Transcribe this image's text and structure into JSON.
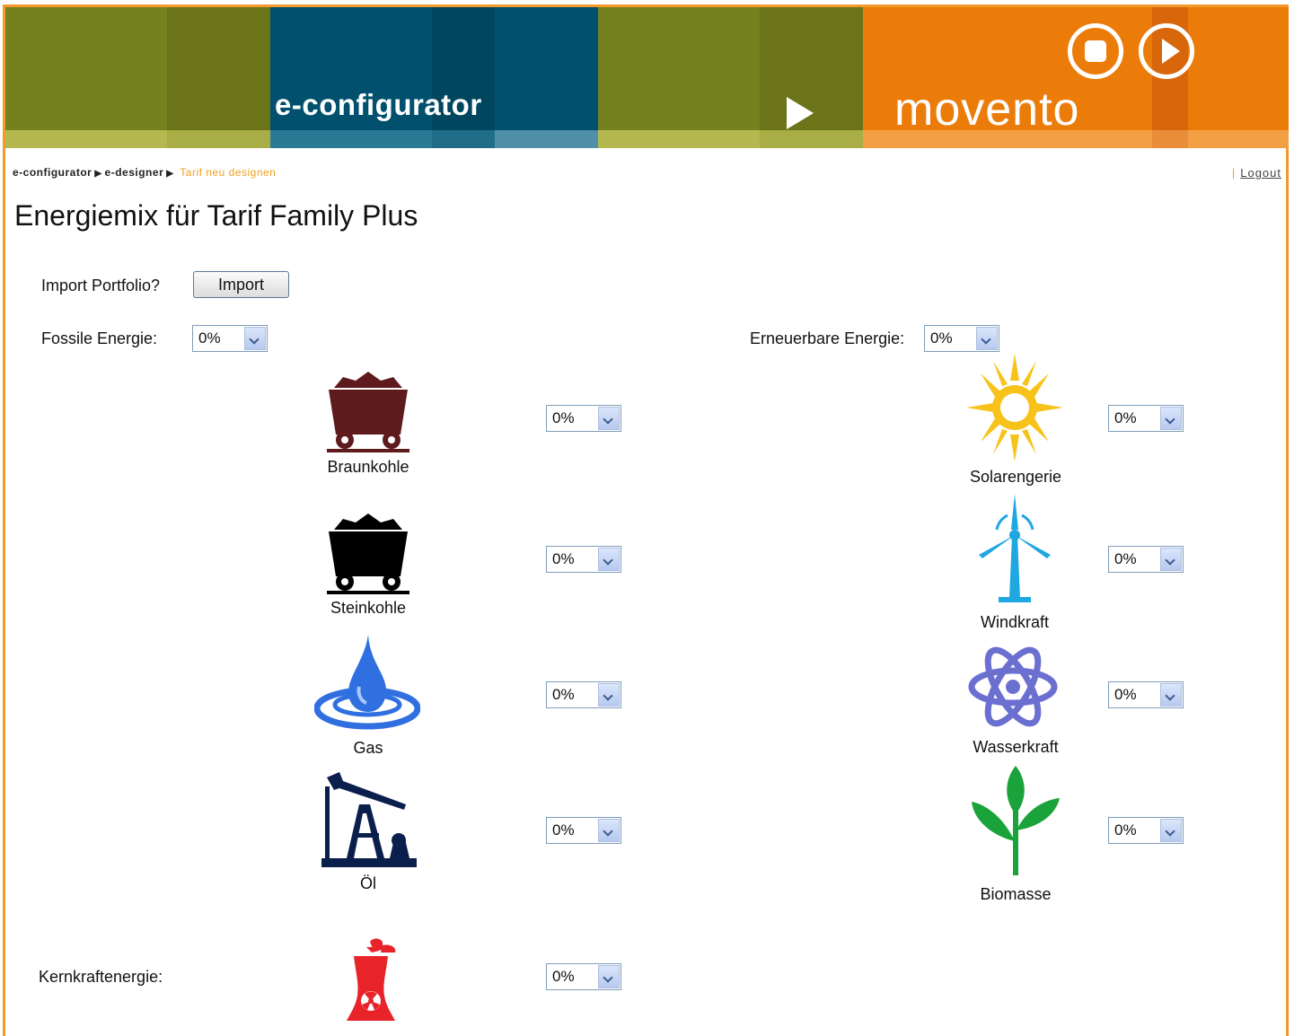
{
  "banner": {
    "title": "e-configurator",
    "brand": "movento",
    "colors": {
      "olive": "#75801e",
      "teal": "#00506e",
      "orange": "#ec7c0a"
    }
  },
  "breadcrumb": {
    "items": [
      "e-configurator",
      "e-designer"
    ],
    "current": "Tarif neu designen"
  },
  "logout": "Logout",
  "page_title": "Energiemix für Tarif Family Plus",
  "import": {
    "label": "Import Portfolio?",
    "button": "Import"
  },
  "fossil": {
    "label": "Fossile Energie:",
    "value": "0%"
  },
  "renewable": {
    "label": "Erneuerbare Energie:",
    "value": "0%"
  },
  "nuclear": {
    "label": "Kernkraftenergie:",
    "value": "0%",
    "icon": "nuclear-plant-icon",
    "color": "#e8232a"
  },
  "fossil_items": [
    {
      "name": "Braunkohle",
      "value": "0%",
      "icon": "coal-cart-icon",
      "color": "#5e1a1c"
    },
    {
      "name": "Steinkohle",
      "value": "0%",
      "icon": "coal-cart-icon",
      "color": "#000000"
    },
    {
      "name": "Gas",
      "value": "0%",
      "icon": "gas-drop-icon",
      "color": "#2f6fe0"
    },
    {
      "name": "Öl",
      "value": "0%",
      "icon": "oil-pump-icon",
      "color": "#0b1f4d"
    }
  ],
  "renewable_items": [
    {
      "name": "Solarengerie",
      "value": "0%",
      "icon": "sun-icon",
      "color": "#f7c21a"
    },
    {
      "name": "Windkraft",
      "value": "0%",
      "icon": "wind-turbine-icon",
      "color": "#1ea7e1"
    },
    {
      "name": "Wasserkraft",
      "value": "0%",
      "icon": "atom-icon",
      "color": "#6b6fd0"
    },
    {
      "name": "Biomasse",
      "value": "0%",
      "icon": "plant-icon",
      "color": "#1aa33a"
    }
  ]
}
